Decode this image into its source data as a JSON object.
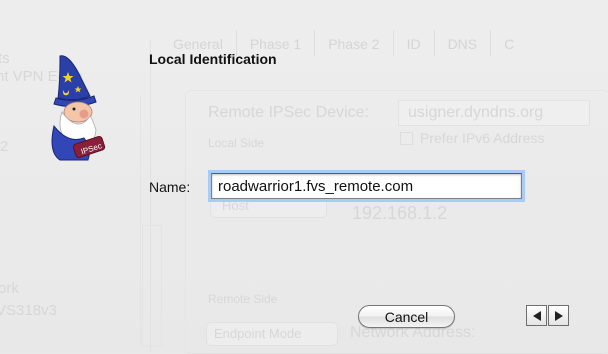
{
  "background": {
    "tabs": [
      "General",
      "Phase 1",
      "Phase 2",
      "ID",
      "DNS",
      "C"
    ],
    "sidebar_lines": [
      "ts",
      "nt VPN Edge",
      "2",
      "ork",
      "VS318v3"
    ],
    "remote_device_label": "Remote IPSec Device:",
    "remote_device_value": "usigner.dyndns.org",
    "prefer_ipv6_label": "Prefer IPv6 Address",
    "local_side_label": "Local Side",
    "host_popup_value": "Host",
    "ip_address_value": "192.168.1.2",
    "remote_side_label": "Remote Side",
    "endpoint_mode_label": "Endpoint Mode",
    "network_address_label": "Network Address:"
  },
  "dialog": {
    "title": "Local Identification",
    "name_label": "Name:",
    "name_value": "roadwarrior1.fvs_remote.com",
    "cancel_label": "Cancel",
    "wizard_badge": "IPSec"
  }
}
